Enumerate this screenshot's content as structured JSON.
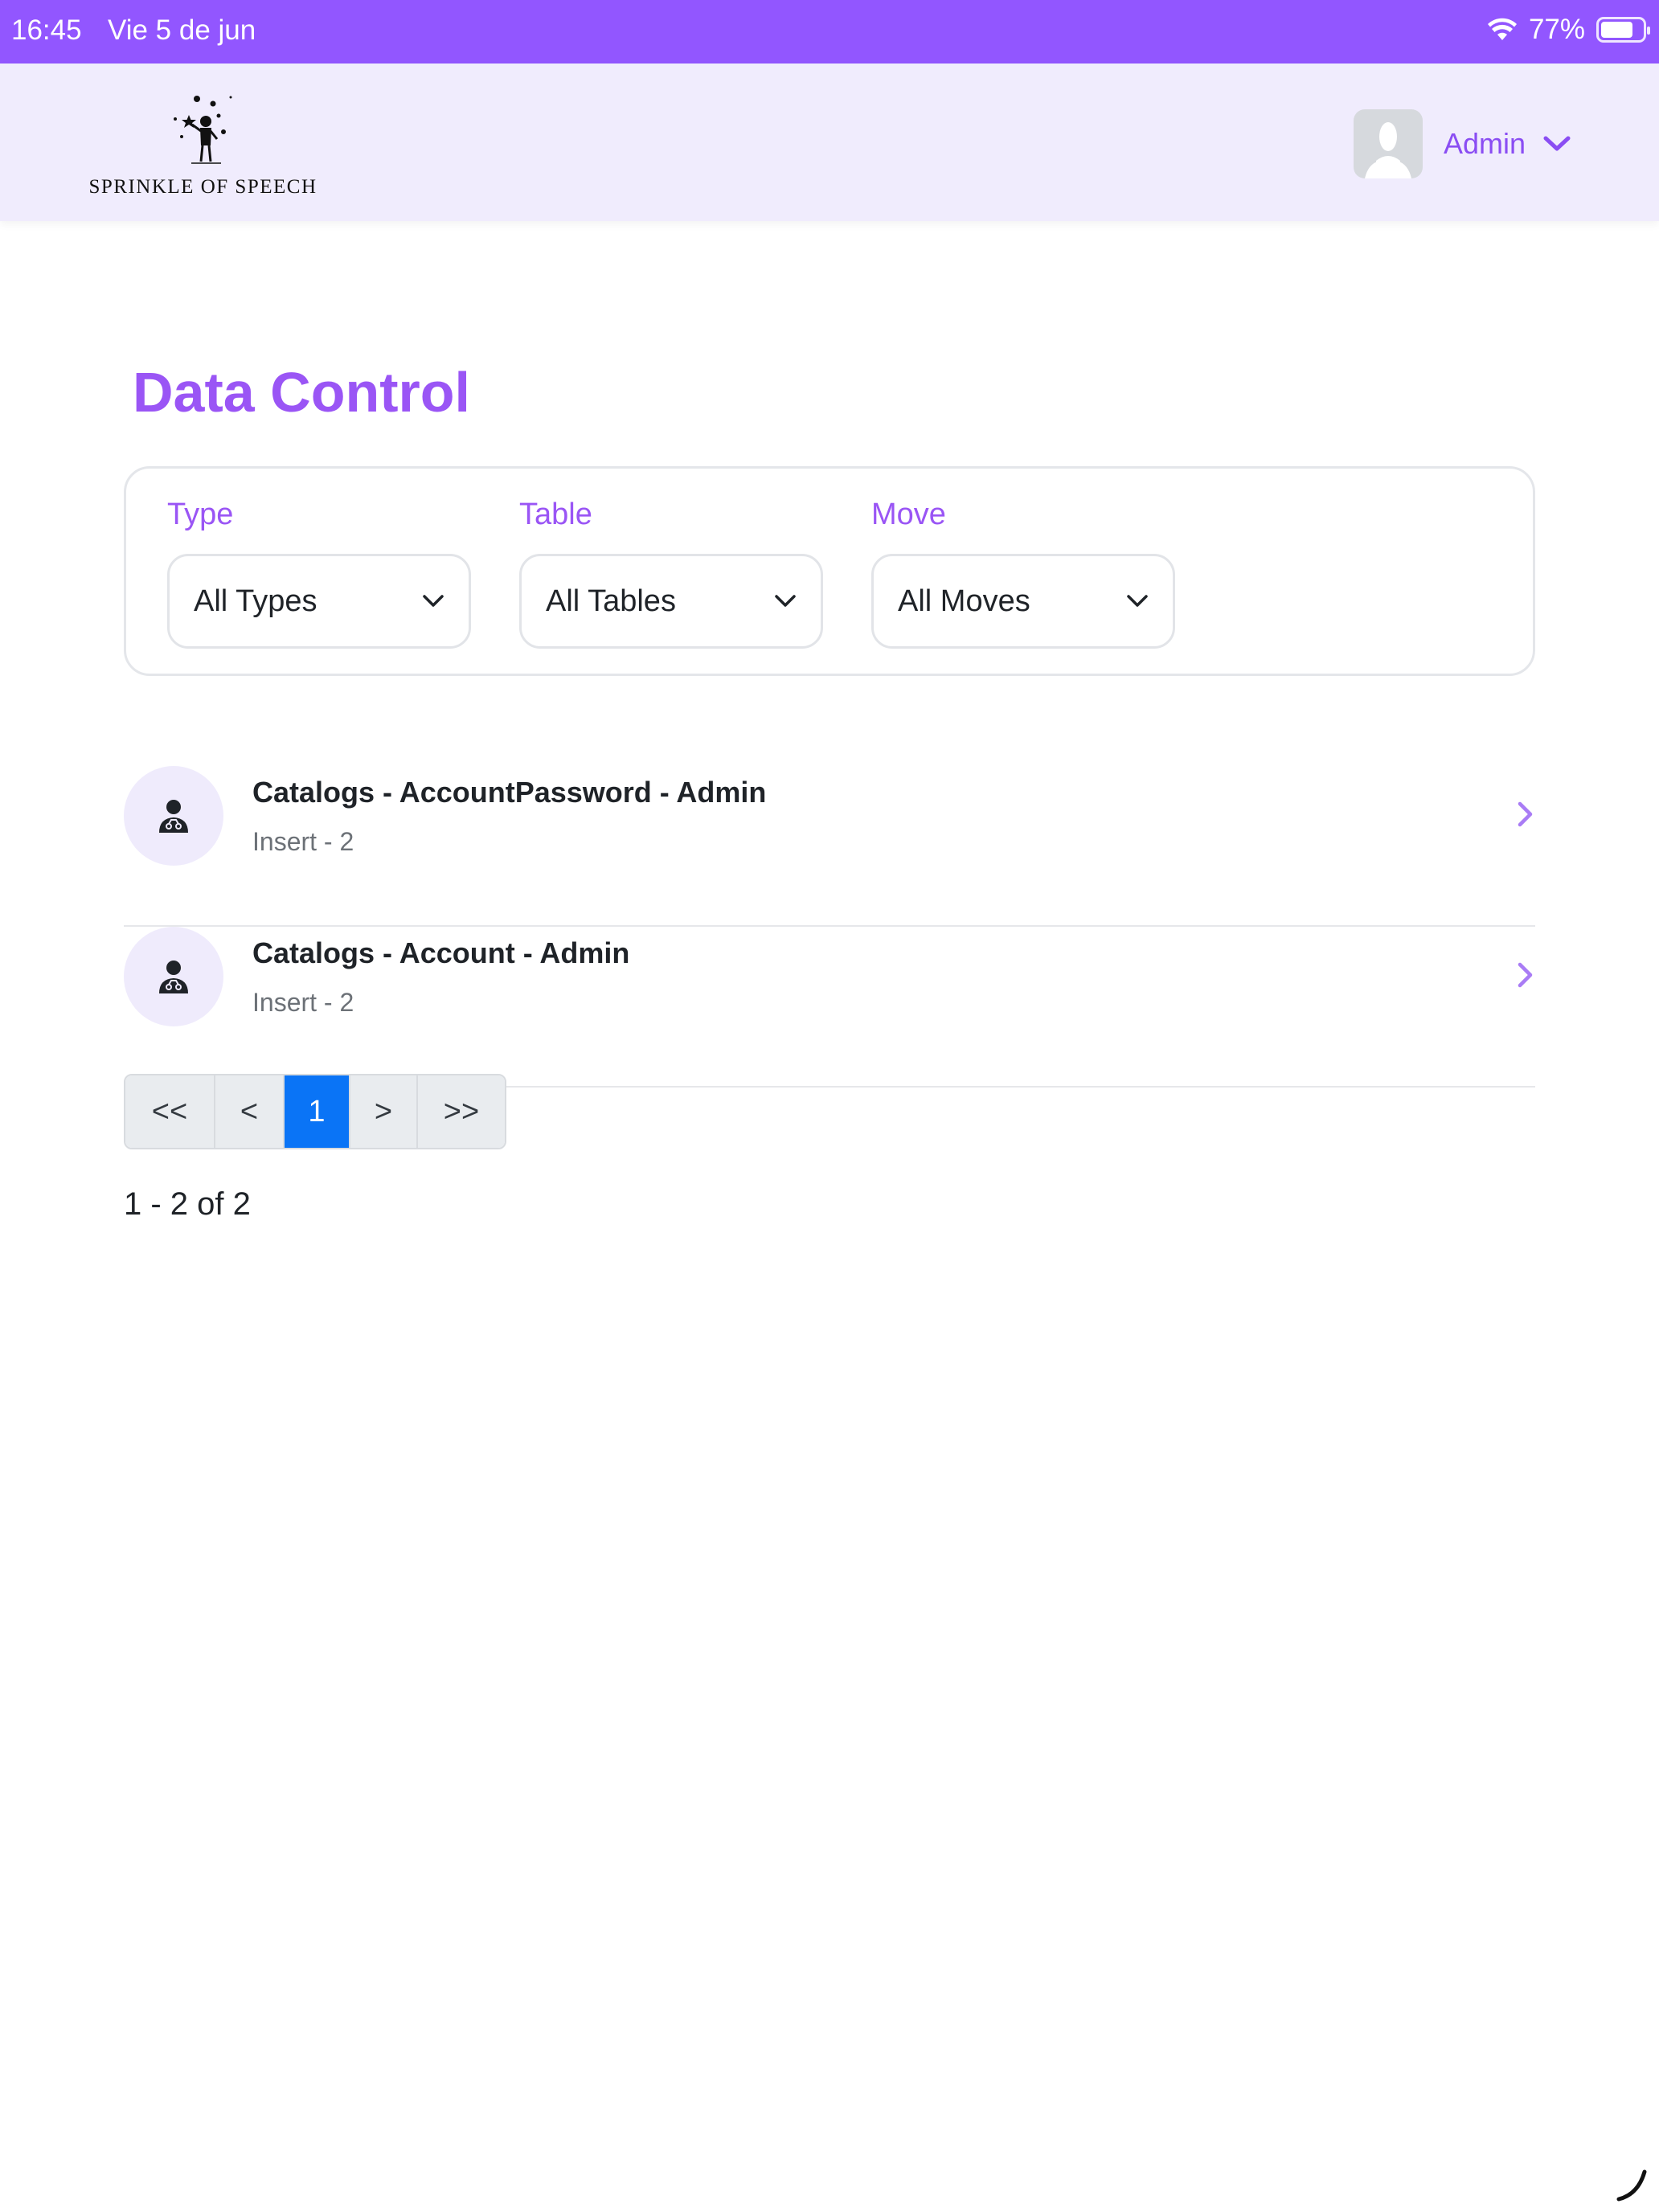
{
  "status_bar": {
    "time": "16:45",
    "date": "Vie 5 de jun",
    "battery": "77%",
    "battery_level": 0.77
  },
  "header": {
    "logo_text": "SPRINKLE OF SPEECH",
    "user_name": "Admin"
  },
  "page": {
    "title": "Data Control"
  },
  "filters": {
    "type": {
      "label": "Type",
      "value": "All Types"
    },
    "table": {
      "label": "Table",
      "value": "All Tables"
    },
    "move": {
      "label": "Move",
      "value": "All Moves"
    }
  },
  "items": [
    {
      "title": "Catalogs - AccountPassword - Admin",
      "subtitle": "Insert - 2"
    },
    {
      "title": "Catalogs - Account - Admin",
      "subtitle": "Insert - 2"
    }
  ],
  "pagination": {
    "first": "<<",
    "prev": "<",
    "current": "1",
    "next": ">",
    "last": ">>",
    "summary": "1 - 2 of 2"
  },
  "colors": {
    "accent": "#9256ff",
    "title": "#9a55f5",
    "active_page": "#0a74f6",
    "header_bg": "#f0ecfd"
  }
}
